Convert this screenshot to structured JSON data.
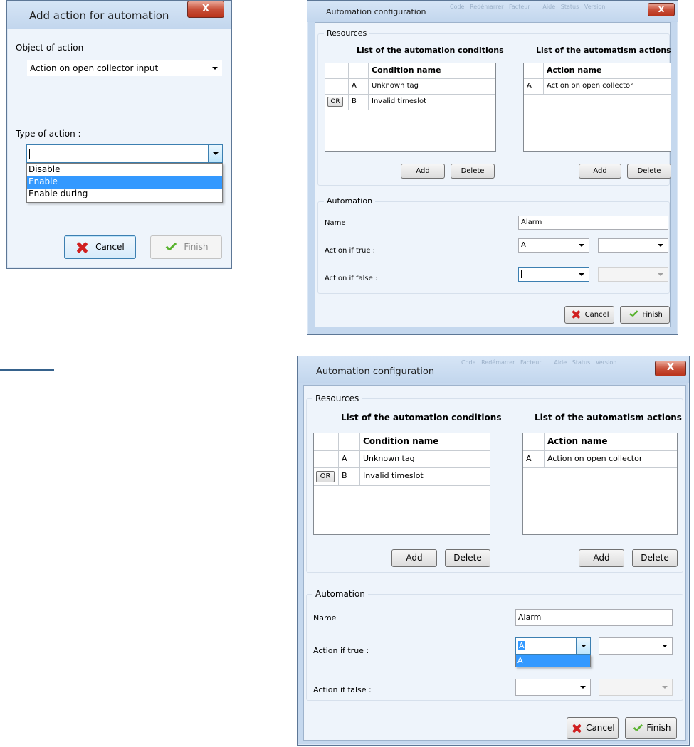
{
  "add_dialog": {
    "title": "Add action for automation",
    "close_label": "X",
    "object_label": "Object of action",
    "object_value": "Action on open collector input",
    "type_label": "Type of action :",
    "type_value": "",
    "type_options": [
      "Disable",
      "Enable",
      "Enable during"
    ],
    "type_selected": "Enable",
    "cancel_label": "Cancel",
    "finish_label": "Finish"
  },
  "config_top": {
    "title": "Automation configuration",
    "close_label": "X",
    "resources_label": "Resources",
    "conditions_title": "List of the automation conditions",
    "actions_title": "List of the automatism actions",
    "conditions_header": "Condition name",
    "conditions": [
      {
        "op": "",
        "letter": "A",
        "name": "Unknown tag"
      },
      {
        "op": "OR",
        "letter": "B",
        "name": "Invalid timeslot"
      }
    ],
    "actions_header": "Action name",
    "actions": [
      {
        "letter": "A",
        "name": "Action on open collector"
      }
    ],
    "add_label": "Add",
    "delete_label": "Delete",
    "automation_label": "Automation",
    "name_label": "Name",
    "name_value": "Alarm",
    "true_label": "Action if true :",
    "true_value": "A",
    "false_label": "Action if false :",
    "false_value": "",
    "cancel_label": "Cancel",
    "finish_label": "Finish"
  },
  "config_bottom": {
    "title": "Automation configuration",
    "close_label": "X",
    "resources_label": "Resources",
    "conditions_title": "List of the automation conditions",
    "actions_title": "List of the automatism actions",
    "conditions_header": "Condition name",
    "conditions": [
      {
        "op": "",
        "letter": "A",
        "name": "Unknown tag"
      },
      {
        "op": "OR",
        "letter": "B",
        "name": "Invalid timeslot"
      }
    ],
    "actions_header": "Action name",
    "actions": [
      {
        "letter": "A",
        "name": "Action on open collector"
      }
    ],
    "add_label": "Add",
    "delete_label": "Delete",
    "automation_label": "Automation",
    "name_label": "Name",
    "name_value": "Alarm",
    "true_label": "Action if true :",
    "true_value": "A",
    "true_options": [
      "A"
    ],
    "false_label": "Action if false :",
    "false_value": "",
    "cancel_label": "Cancel",
    "finish_label": "Finish"
  },
  "colors": {
    "window_frame": "#c5d8ee",
    "client_bg": "#eef4fb",
    "selection": "#3399ff",
    "close_button": "#c8503a",
    "cancel_icon": "#d02020",
    "finish_icon": "#58b22d"
  },
  "icons": [
    "close-icon",
    "cancel-x-icon",
    "finish-check-icon",
    "dropdown-arrow-icon"
  ]
}
